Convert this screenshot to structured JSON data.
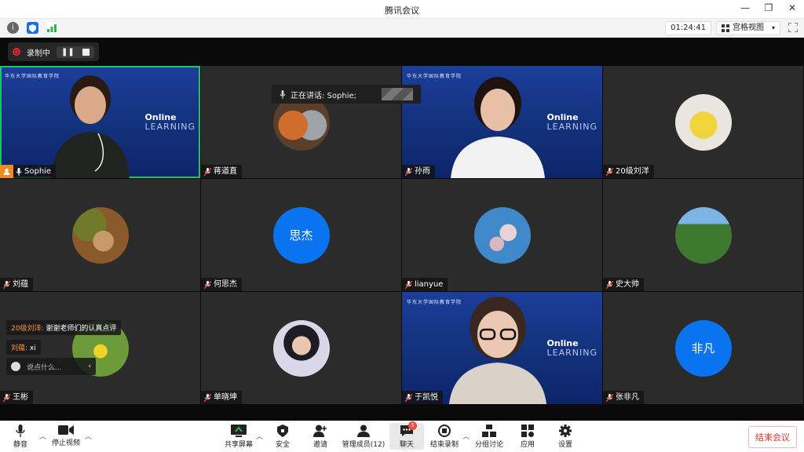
{
  "window": {
    "title": "腾讯会议",
    "controls": [
      "—",
      "❐",
      "✕"
    ]
  },
  "infobar": {
    "timer": "01:24:41",
    "view_label": "宫格视图",
    "view_caret": "▾"
  },
  "recording": {
    "label": "录制中"
  },
  "speaking": {
    "label": "正在讲话: Sophie;"
  },
  "brand": {
    "online": "Online",
    "learning": "LEARNING",
    "school": "华东大学国际教育学院"
  },
  "participants": [
    {
      "name": "Sophie",
      "kind": "video"
    },
    {
      "name": "蒋道直",
      "kind": "image"
    },
    {
      "name": "孙雨",
      "kind": "video"
    },
    {
      "name": "20级刘洋",
      "kind": "image"
    },
    {
      "name": "刘蕴",
      "kind": "image"
    },
    {
      "name": "何思杰",
      "kind": "text",
      "avatar_text": "思杰"
    },
    {
      "name": "lianyue",
      "kind": "image"
    },
    {
      "name": "史大帅",
      "kind": "image"
    },
    {
      "name": "王彬",
      "kind": "image"
    },
    {
      "name": "单晓坤",
      "kind": "image"
    },
    {
      "name": "于凯悦",
      "kind": "video"
    },
    {
      "name": "张非凡",
      "kind": "text",
      "avatar_text": "非凡"
    }
  ],
  "chat": {
    "messages": [
      {
        "sender": "20级刘洋:",
        "text": "谢谢老师们的认真点评"
      },
      {
        "sender": "刘蕴:",
        "text": "xi"
      }
    ],
    "placeholder": "说点什么..."
  },
  "toolbar": {
    "mute": "静音",
    "stop_video": "停止视频",
    "share": "共享屏幕",
    "security": "安全",
    "invite": "邀请",
    "members": "管理成员(12)",
    "chat": "聊天",
    "chat_badge": "5",
    "end_record": "结束录制",
    "breakout": "分组讨论",
    "apps": "应用",
    "settings": "设置",
    "end_meeting": "结束会议"
  },
  "colors": {
    "accent_blue": "#0a73f0",
    "active_speaker": "#22c06a",
    "host_orange": "#f28a1e",
    "end_red": "#e0342a"
  }
}
